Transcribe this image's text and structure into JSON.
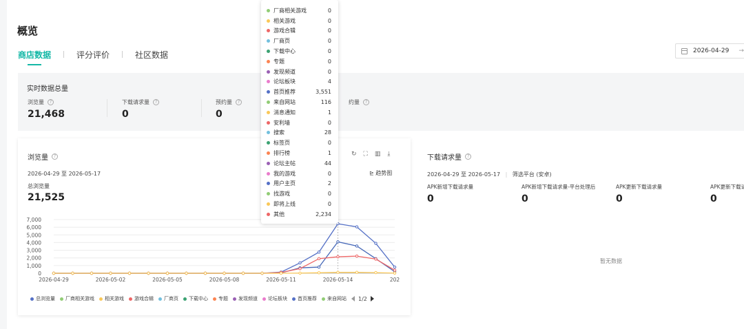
{
  "page": {
    "title": "概览"
  },
  "tabs": [
    {
      "label": "商店数据",
      "active": true
    },
    {
      "label": "评分评价",
      "active": false
    },
    {
      "label": "社区数据",
      "active": false
    }
  ],
  "date_picker": {
    "start": "2026-04-29",
    "separator": "→"
  },
  "realtime": {
    "title": "实时数据总量",
    "metrics": [
      {
        "label": "浏览量",
        "value": "21,468"
      },
      {
        "label": "下载请求量",
        "value": "0"
      },
      {
        "label": "预约量",
        "value": "0"
      },
      {
        "label": "约量",
        "value": ""
      }
    ]
  },
  "views_card": {
    "title": "浏览量",
    "range": "2026-04-29 至 2026-05-17",
    "total_label": "总浏览量",
    "total_value": "21,525",
    "trend_label": "趋势图",
    "legend_page": "1/2"
  },
  "download_card": {
    "title": "下载请求量",
    "range": "2026-04-29 至 2026-05-17",
    "filter": "筛选平台 (安卓)",
    "metrics": [
      {
        "label": "APK新增下载请求量",
        "value": "0"
      },
      {
        "label": "APK新增下载请求量-平台处理后",
        "value": "0"
      },
      {
        "label": "APK更新下载请求量",
        "value": "0"
      },
      {
        "label": "APK更新下载请",
        "value": "0"
      }
    ],
    "no_data": "暂无数据"
  },
  "icons": {
    "help": "question-circle-icon",
    "calendar": "calendar-icon",
    "refresh": "refresh-icon",
    "expand": "expand-icon",
    "data_view": "data-view-icon",
    "download": "download-icon",
    "trend": "trend-chart-icon"
  },
  "chart_data": {
    "type": "line",
    "x": [
      "2026-04-29",
      "2026-04-30",
      "2026-05-01",
      "2026-05-02",
      "2026-05-03",
      "2026-05-04",
      "2026-05-05",
      "2026-05-06",
      "2026-05-07",
      "2026-05-08",
      "2026-05-09",
      "2026-05-10",
      "2026-05-11",
      "2026-05-12",
      "2026-05-13",
      "2026-05-14",
      "2026-05-15",
      "2026-05-16",
      "2026-05-17"
    ],
    "x_tick_labels": [
      "2026-04-29",
      "2026-05-02",
      "2026-05-05",
      "2026-05-08",
      "2026-05-11",
      "2026-05-14",
      "202"
    ],
    "y_ticks": [
      "0",
      "1,000",
      "2,000",
      "3,000",
      "4,000",
      "5,000",
      "6,000",
      "7,000"
    ],
    "ylim": [
      0,
      7000
    ],
    "series": [
      {
        "name": "总浏览量",
        "color": "#5470c6",
        "values": [
          0,
          0,
          0,
          0,
          0,
          0,
          0,
          0,
          0,
          0,
          0,
          0,
          150,
          1350,
          2750,
          6450,
          6050,
          3900,
          800
        ]
      },
      {
        "name": "首页推荐",
        "color": "#4668b8",
        "values": [
          0,
          0,
          0,
          0,
          0,
          0,
          0,
          0,
          0,
          0,
          0,
          0,
          50,
          700,
          800,
          4100,
          3550,
          1900,
          200
        ]
      },
      {
        "name": "游戏合辑",
        "color": "#ee6666",
        "values": [
          0,
          0,
          0,
          0,
          0,
          0,
          0,
          0,
          0,
          0,
          0,
          0,
          100,
          600,
          1900,
          2150,
          2234,
          1850,
          400
        ]
      },
      {
        "name": "相关游戏",
        "color": "#fac858",
        "values": [
          0,
          0,
          0,
          0,
          0,
          0,
          0,
          0,
          0,
          0,
          0,
          0,
          0,
          20,
          60,
          120,
          116,
          80,
          20
        ]
      }
    ],
    "legend": [
      {
        "name": "总浏览量",
        "color": "#5470c6"
      },
      {
        "name": "厂商相关游戏",
        "color": "#91cc75"
      },
      {
        "name": "相关游戏",
        "color": "#fac858"
      },
      {
        "name": "游戏合辑",
        "color": "#ee6666"
      },
      {
        "name": "厂商页",
        "color": "#73c0de"
      },
      {
        "name": "下载中心",
        "color": "#3ba272"
      },
      {
        "name": "专题",
        "color": "#fc8452"
      },
      {
        "name": "发现频道",
        "color": "#9a60b4"
      },
      {
        "name": "论坛板块",
        "color": "#ea7ccc"
      },
      {
        "name": "首页推荐",
        "color": "#5470c6"
      },
      {
        "name": "来自网站",
        "color": "#91cc75"
      }
    ],
    "tooltip": [
      {
        "name": "厂商相关游戏",
        "value": "0",
        "color": "#91cc75"
      },
      {
        "name": "相关游戏",
        "value": "0",
        "color": "#fac858"
      },
      {
        "name": "游戏合辑",
        "value": "0",
        "color": "#ee6666"
      },
      {
        "name": "厂商页",
        "value": "0",
        "color": "#73c0de"
      },
      {
        "name": "下载中心",
        "value": "0",
        "color": "#3ba272"
      },
      {
        "name": "专题",
        "value": "0",
        "color": "#fc8452"
      },
      {
        "name": "发现频道",
        "value": "0",
        "color": "#9a60b4"
      },
      {
        "name": "论坛板块",
        "value": "4",
        "color": "#ea7ccc"
      },
      {
        "name": "首页推荐",
        "value": "3,551",
        "color": "#5470c6"
      },
      {
        "name": "来自网站",
        "value": "116",
        "color": "#91cc75"
      },
      {
        "name": "消息通知",
        "value": "1",
        "color": "#fac858"
      },
      {
        "name": "安利墙",
        "value": "0",
        "color": "#ee6666"
      },
      {
        "name": "搜索",
        "value": "28",
        "color": "#73c0de"
      },
      {
        "name": "标签页",
        "value": "0",
        "color": "#3ba272"
      },
      {
        "name": "排行榜",
        "value": "1",
        "color": "#fc8452"
      },
      {
        "name": "论坛主帖",
        "value": "44",
        "color": "#9a60b4"
      },
      {
        "name": "我的游戏",
        "value": "0",
        "color": "#ea7ccc"
      },
      {
        "name": "用户主页",
        "value": "2",
        "color": "#5470c6"
      },
      {
        "name": "找游戏",
        "value": "0",
        "color": "#91cc75"
      },
      {
        "name": "即将上线",
        "value": "0",
        "color": "#fac858"
      },
      {
        "name": "其他",
        "value": "2,234",
        "color": "#ee6666"
      }
    ]
  }
}
